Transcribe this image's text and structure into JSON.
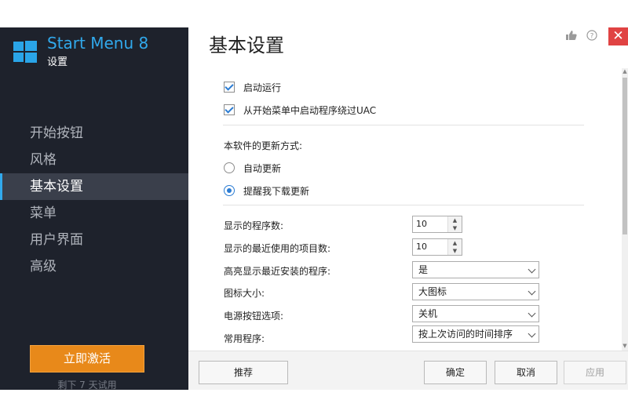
{
  "app": {
    "title": "Start Menu 8",
    "subtitle": "设置"
  },
  "sidebar": {
    "items": [
      {
        "label": "开始按钮"
      },
      {
        "label": "风格"
      },
      {
        "label": "基本设置"
      },
      {
        "label": "菜单"
      },
      {
        "label": "用户界面"
      },
      {
        "label": "高级"
      }
    ],
    "active_index": 2,
    "activate_label": "立即激活",
    "trial_text": "剩下 7 天试用"
  },
  "header": {
    "title": "基本设置",
    "icons": [
      "thumbs-up-icon",
      "help-icon"
    ],
    "close_label": "✕"
  },
  "settings": {
    "startup_label": "启动运行",
    "startup_checked": true,
    "bypass_uac_label": "从开始菜单中启动程序绕过UAC",
    "bypass_uac_checked": true,
    "update_method_label": "本软件的更新方式:",
    "update_auto_label": "自动更新",
    "update_remind_label": "提醒我下载更新",
    "update_selected": "remind",
    "programs_count_label": "显示的程序数:",
    "programs_count_value": "10",
    "recent_items_label": "显示的最近使用的项目数:",
    "recent_items_value": "10",
    "highlight_new_label": "高亮显示最近安装的程序:",
    "highlight_new_value": "是",
    "icon_size_label": "图标大小:",
    "icon_size_value": "大图标",
    "power_button_label": "电源按钮选项:",
    "power_button_value": "关机",
    "common_programs_label": "常用程序:",
    "common_programs_value": "按上次访问的时间排序"
  },
  "footer": {
    "recommend_label": "推荐",
    "ok_label": "确定",
    "cancel_label": "取消",
    "apply_label": "应用"
  },
  "colors": {
    "sidebar_bg": "#1e222c",
    "accent": "#31a9ec",
    "activate_button": "#e8891a",
    "close_button": "#e04343"
  }
}
